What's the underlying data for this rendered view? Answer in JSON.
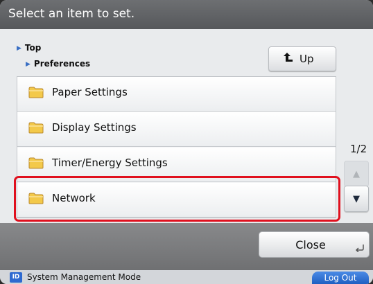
{
  "header": {
    "title": "Select an item to set."
  },
  "breadcrumb": {
    "top": "Top",
    "current": "Preferences"
  },
  "up_button": {
    "label": "Up"
  },
  "list": {
    "items": [
      {
        "label": "Paper Settings",
        "icon": "folder-icon"
      },
      {
        "label": "Display Settings",
        "icon": "folder-icon"
      },
      {
        "label": "Timer/Energy Settings",
        "icon": "folder-icon"
      },
      {
        "label": "Network",
        "icon": "folder-icon",
        "highlighted": true
      }
    ],
    "page_indicator": "1/2"
  },
  "footer": {
    "close_label": "Close"
  },
  "status_bar": {
    "badge": "ID",
    "mode_text": "System Management Mode",
    "logout_label": "Log Out"
  },
  "colors": {
    "highlight": "#e0101e",
    "accent_blue": "#2e6ad0",
    "header_gray": "#5f6164"
  }
}
